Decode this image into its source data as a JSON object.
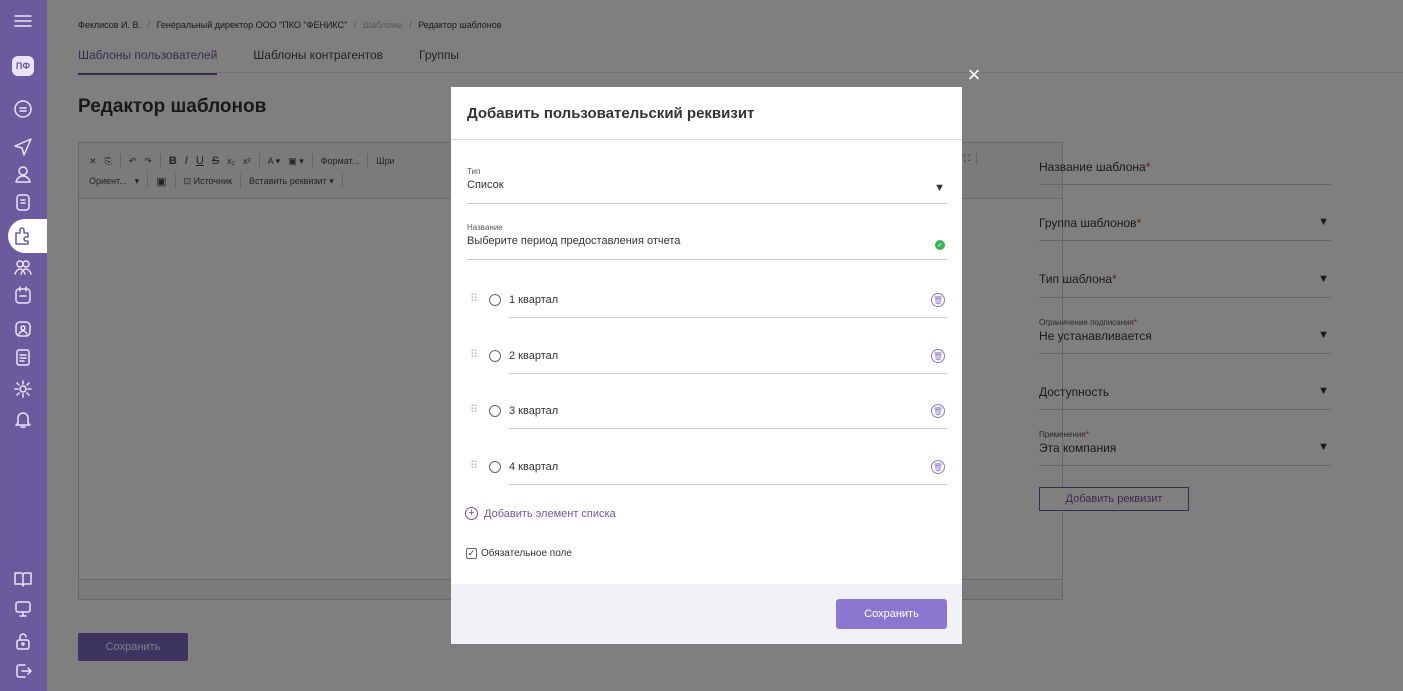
{
  "sidebar": {
    "logo": "ПФ"
  },
  "breadcrumb": {
    "user": "Феклисов И. В.",
    "company": "Генеральный директор ООО \"ПКО \"ФЕНИКС\"",
    "section": "Шаблоны",
    "current": "Редактор шаблонов",
    "separator": "/"
  },
  "tabs": [
    {
      "label": "Шаблоны пользователей"
    },
    {
      "label": "Шаблоны контрагентов"
    },
    {
      "label": "Группы"
    }
  ],
  "page": {
    "title": "Редактор шаблонов",
    "save_label": "Сохранить"
  },
  "editor": {
    "row1": [
      "✕",
      "⎘",
      "↶",
      "↷",
      "B",
      "I",
      "U",
      "S",
      "x₂",
      "x²",
      "A ▾",
      "▣ ▾",
      "Формат...",
      "Шри"
    ],
    "row2": [
      "Ориент...",
      "▾",
      "▣",
      "⊡ Источник",
      "Вставить реквизит ▾"
    ],
    "tail_icon": "⛶"
  },
  "right_panel": {
    "template_name": {
      "label": "Название шаблона",
      "required": "*"
    },
    "template_group": {
      "label": "Группа шаблонов",
      "required": "*"
    },
    "template_type": {
      "label": "Тип шаблона",
      "required": "*"
    },
    "sign_limit": {
      "label": "Ограничение подписания",
      "required": "*",
      "value": "Не устанавливается"
    },
    "availability": {
      "label": "Доступность"
    },
    "application": {
      "label": "Применение",
      "required": "*",
      "value": "Эта компания"
    },
    "add_requisite_label": "Добавить реквизит"
  },
  "modal": {
    "title": "Добавить пользовательский реквизит",
    "type": {
      "label": "Тип",
      "value": "Список"
    },
    "name": {
      "label": "Название",
      "value": "Выберите период предоставления отчета"
    },
    "items": [
      {
        "label": "1 квартал"
      },
      {
        "label": "2 квартал"
      },
      {
        "label": "3 квартал"
      },
      {
        "label": "4 квартал"
      }
    ],
    "add_item_label": "Добавить элемент списка",
    "required_label": "Обязательное поле",
    "save_label": "Сохранить"
  }
}
